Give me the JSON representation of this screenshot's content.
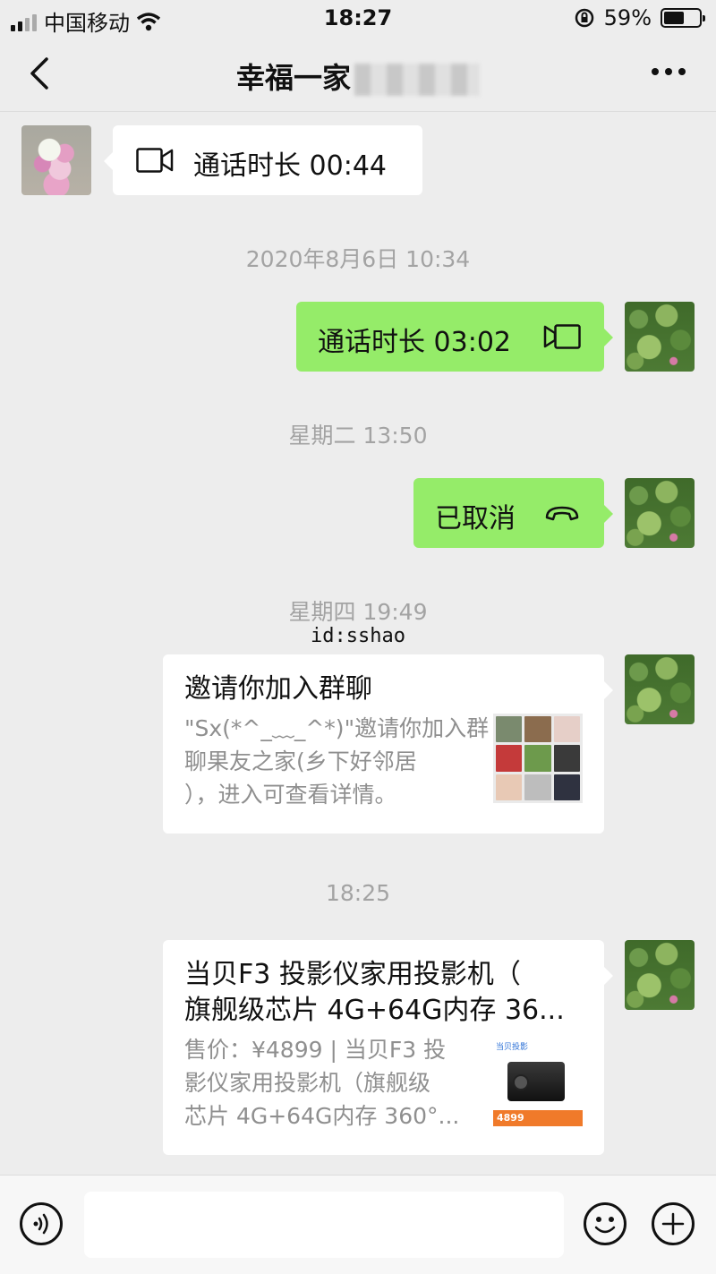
{
  "status_bar": {
    "carrier": "中国移动",
    "time": "18:27",
    "battery_percent": "59%",
    "battery_level": 0.59
  },
  "nav": {
    "title": "幸福一家"
  },
  "messages": {
    "call1": {
      "text": "通话时长 00:44"
    },
    "ts1": "2020年8月6日 10:34",
    "call2": {
      "text": "通话时长 03:02"
    },
    "ts2": "星期二 13:50",
    "call3": {
      "text": "已取消"
    },
    "ts3": "星期四 19:49",
    "watermark": "id:sshao",
    "invite": {
      "title": "邀请你加入群聊",
      "desc_line1": "\"Sx(*^_﹏_^*)\"邀请你加入群",
      "desc_line2": "聊果友之家(乡下好邻居",
      "desc_line3": "），进入可查看详情。"
    },
    "ts4": "18:25",
    "product": {
      "title_line1": "当贝F3 投影仪家用投影机（",
      "title_line2": "旗舰级芯片 4G+64G内存 36...",
      "desc_line1": "售价：¥4899 | 当贝F3 投",
      "desc_line2": "影仪家用投影机（旗舰级",
      "desc_line3": "芯片 4G+64G内存 360°...",
      "thumb_brand": "当贝投影",
      "thumb_price": "4899"
    }
  },
  "icons": {
    "back": "chevron-left-icon",
    "more": "more-dots-icon",
    "video": "video-camera-icon",
    "hangup": "phone-hangup-icon",
    "voice": "voice-icon",
    "emoji": "emoji-icon",
    "add": "plus-icon"
  }
}
